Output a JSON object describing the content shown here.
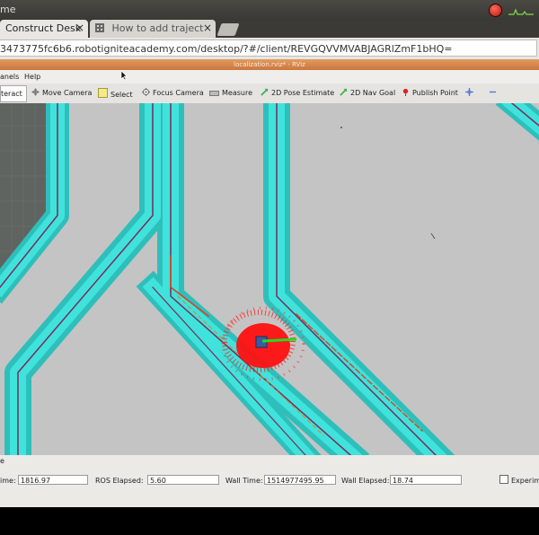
{
  "os_bar": {
    "title": "me"
  },
  "tabs": [
    {
      "label": "Construct Desk",
      "close": "×"
    },
    {
      "label": "How to add traject",
      "close": "×"
    }
  ],
  "url": "3473775fc6b6.robotigniteacademy.com/desktop/?#/client/REVGQVVMVABJAGRlZmF1bHQ=",
  "rviz_window_title": "localization.rviz* - RViz",
  "menu": {
    "panels": "anels",
    "help": "Help"
  },
  "toolbar": [
    {
      "id": "interact",
      "label": "teract",
      "icon": "cursor-icon"
    },
    {
      "id": "move-camera",
      "label": "Move Camera",
      "icon": "move-camera-icon"
    },
    {
      "id": "select",
      "label": "Select",
      "icon": "select-icon"
    },
    {
      "id": "focus-camera",
      "label": "Focus Camera",
      "icon": "focus-camera-icon"
    },
    {
      "id": "measure",
      "label": "Measure",
      "icon": "measure-icon"
    },
    {
      "id": "pose-estimate",
      "label": "2D Pose Estimate",
      "icon": "pose-arrow-icon"
    },
    {
      "id": "nav-goal",
      "label": "2D Nav Goal",
      "icon": "nav-arrow-icon"
    },
    {
      "id": "publish-point",
      "label": "Publish Point",
      "icon": "pin-icon"
    }
  ],
  "time_panel": {
    "header": "e",
    "ros_time_label": "ime:",
    "ros_time": "1816.97",
    "ros_elapsed_label": "ROS Elapsed:",
    "ros_elapsed": "5.60",
    "wall_time_label": "Wall Time:",
    "wall_time": "1514977495.95",
    "wall_elapsed_label": "Wall Elapsed:",
    "wall_elapsed": "18.74",
    "experimental_label": "Experim"
  },
  "colors": {
    "map_bg": "#c4c4c4",
    "costmap": "#39d6d0",
    "inflation": "#2aa7a7",
    "wall": "#7a2a5a",
    "particles": "#ff0000",
    "robot_arrow": "#22dd22"
  }
}
